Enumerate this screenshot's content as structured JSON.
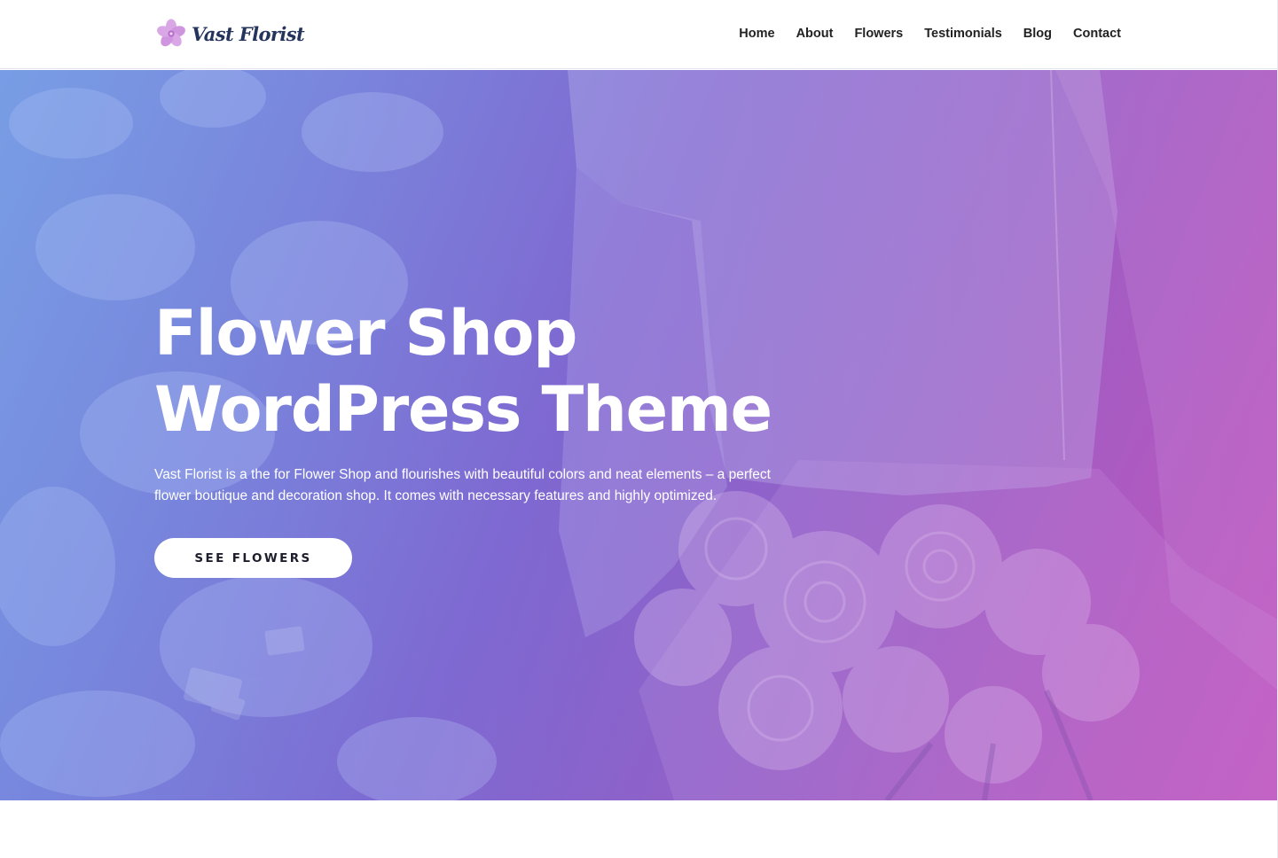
{
  "site": {
    "name": "Vast Florist",
    "brand_color": "#24345c",
    "logo_icon": "flower-icon",
    "logo_icon_color": "#c78ad8"
  },
  "nav": {
    "items": [
      {
        "label": "Home"
      },
      {
        "label": "About"
      },
      {
        "label": "Flowers"
      },
      {
        "label": "Testimonials"
      },
      {
        "label": "Blog"
      },
      {
        "label": "Contact"
      }
    ]
  },
  "hero": {
    "title_line1": "Flower Shop",
    "title_line2": "WordPress Theme",
    "description": "Vast Florist is a the for Flower Shop and flourishes with beautiful colors and neat elements – a perfect flower boutique and decoration shop. It comes with necessary features and highly optimized.",
    "button_label": "SEE FLOWERS",
    "gradient_start": "#7fa3e6",
    "gradient_end": "#c25ac0"
  }
}
